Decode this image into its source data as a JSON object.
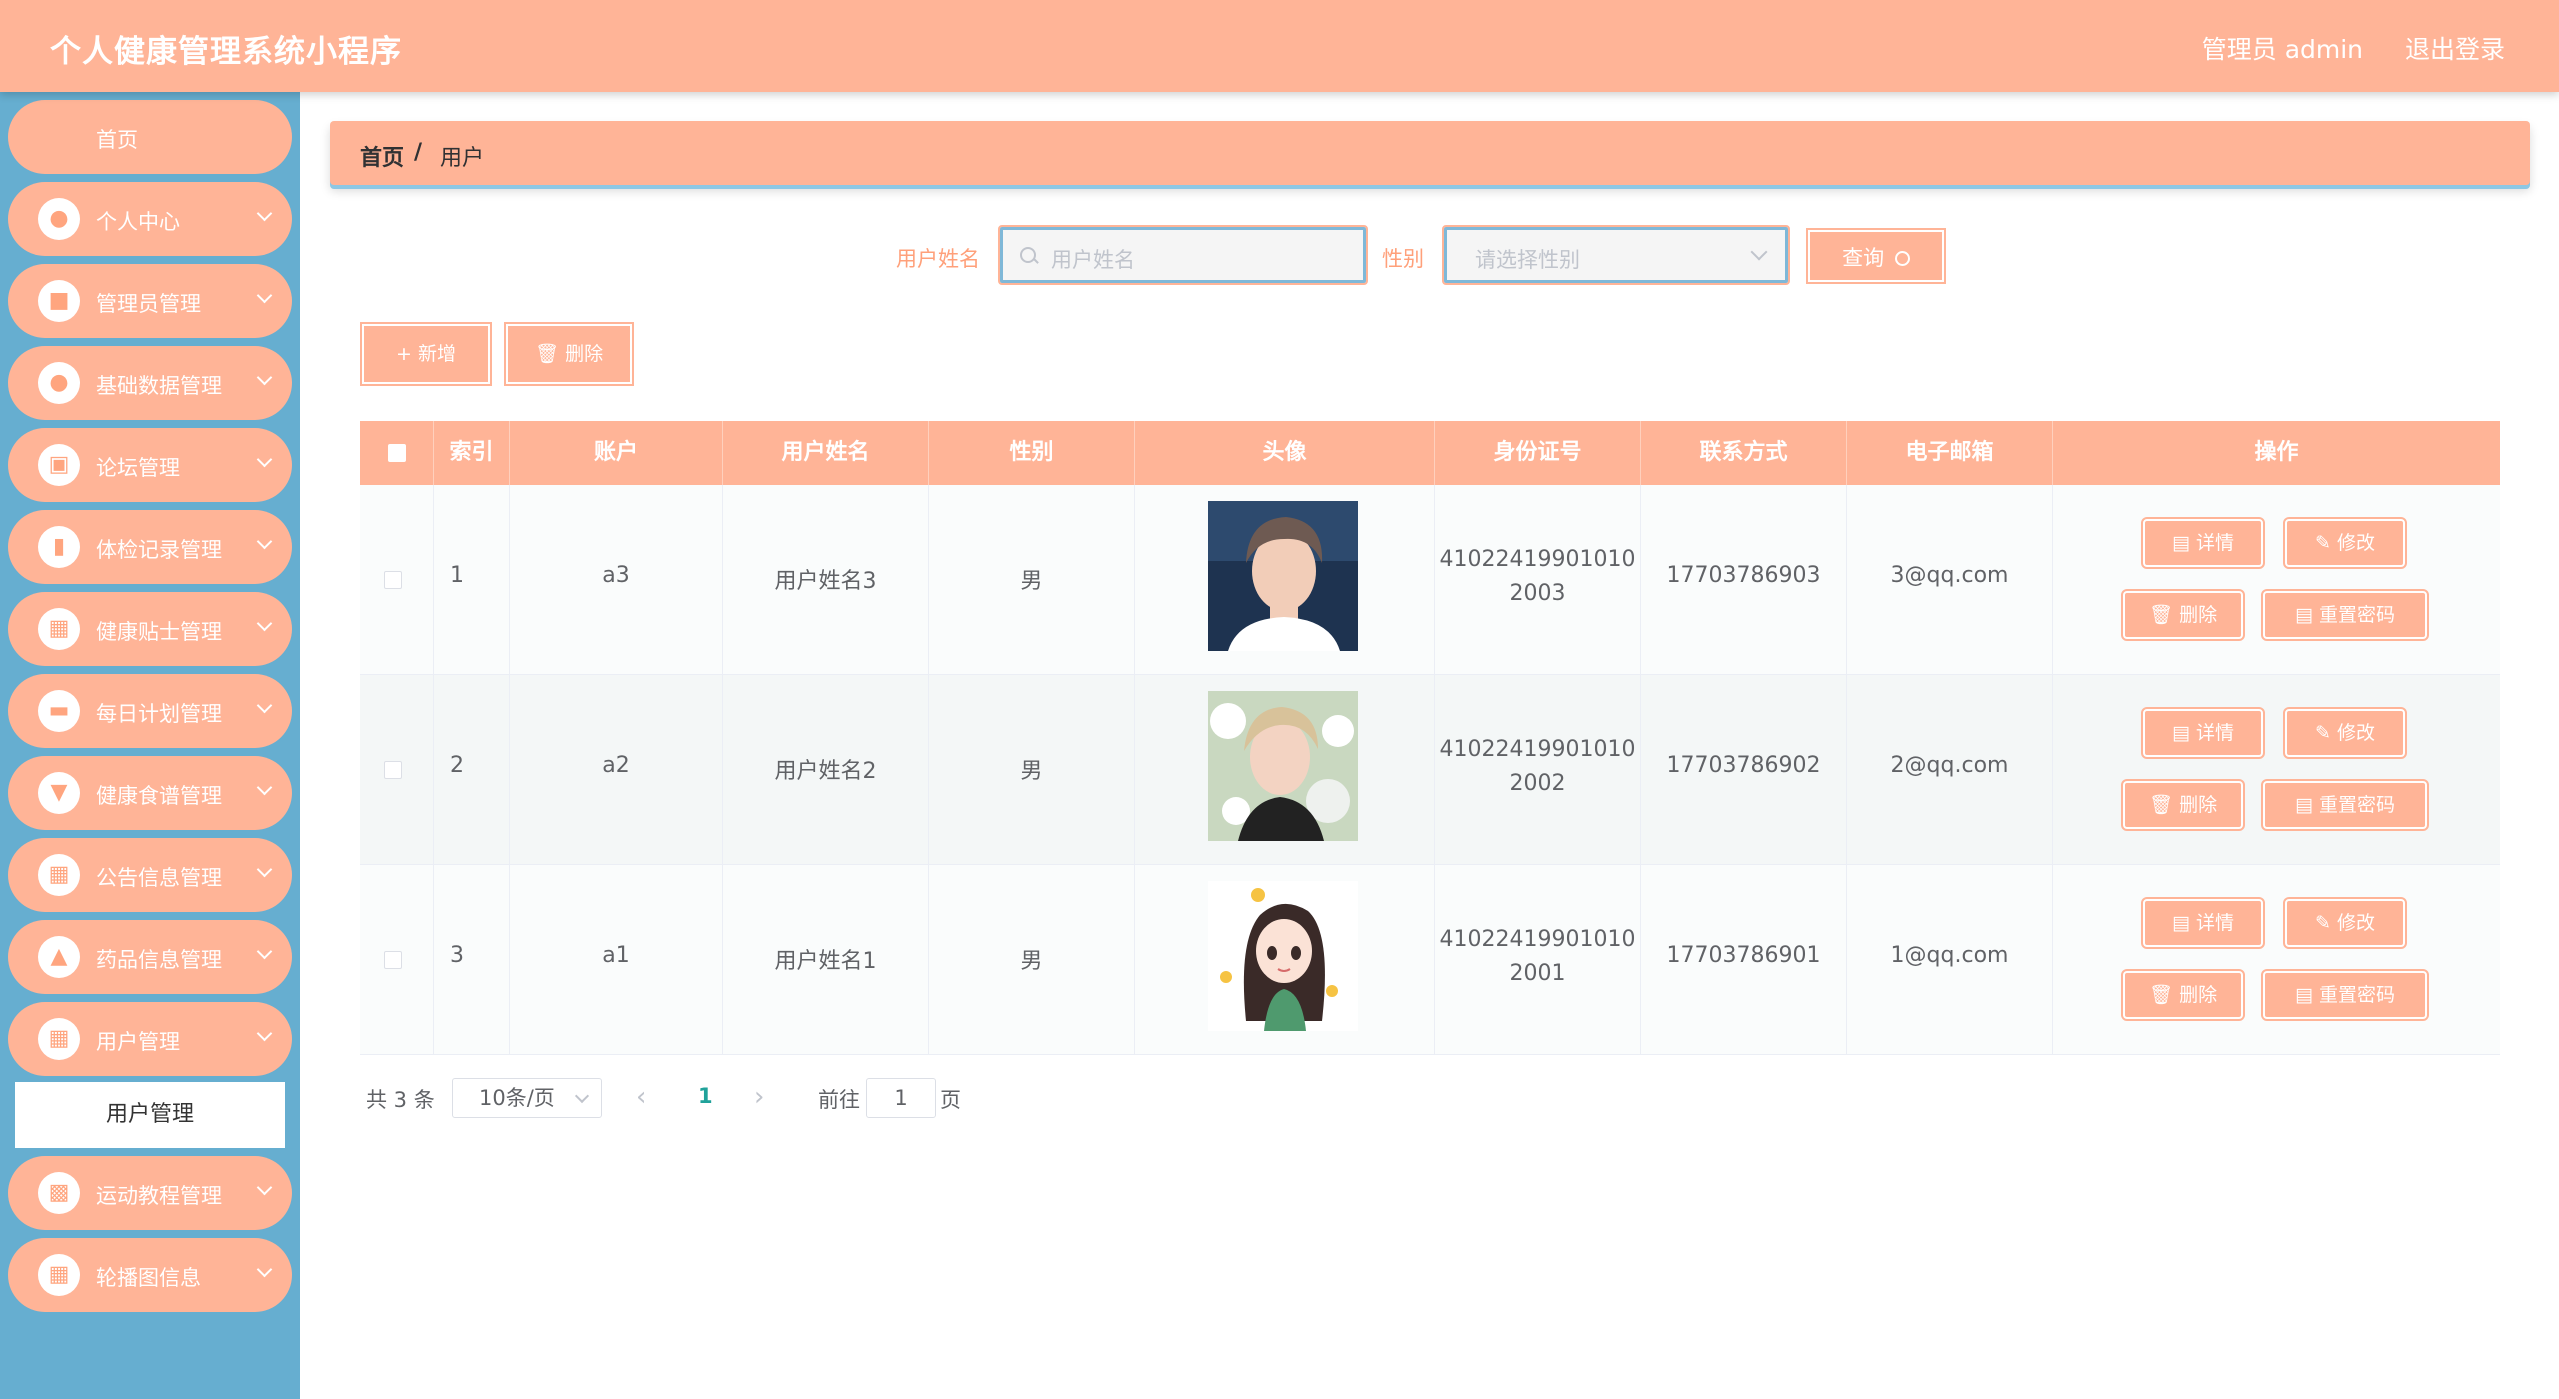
{
  "header": {
    "app_title": "个人健康管理系统小程序",
    "user_label": "管理员 admin",
    "logout_label": "退出登录"
  },
  "colors": {
    "accent": "#ffb497",
    "sidebar_bg": "#66aed0",
    "active_page": "#20a29a"
  },
  "sidebar": {
    "items": [
      {
        "label": "首页",
        "icon": "home"
      },
      {
        "label": "个人中心",
        "icon": "user-icon"
      },
      {
        "label": "管理员管理",
        "icon": "monitor-icon"
      },
      {
        "label": "基础数据管理",
        "icon": "user-icon"
      },
      {
        "label": "论坛管理",
        "icon": "briefcase-icon"
      },
      {
        "label": "体检记录管理",
        "icon": "bar-chart-icon"
      },
      {
        "label": "健康贴士管理",
        "icon": "grid-icon"
      },
      {
        "label": "每日计划管理",
        "icon": "wallet-icon"
      },
      {
        "label": "健康食谱管理",
        "icon": "cup-icon"
      },
      {
        "label": "公告信息管理",
        "icon": "grid-icon"
      },
      {
        "label": "药品信息管理",
        "icon": "chart-icon"
      },
      {
        "label": "用户管理",
        "icon": "grid-icon"
      },
      {
        "label": "运动教程管理",
        "icon": "ticket-icon"
      },
      {
        "label": "轮播图信息",
        "icon": "grid-icon"
      }
    ],
    "submenu_active": "用户管理"
  },
  "breadcrumb": {
    "home": "首页",
    "separator": "/",
    "current": "用户"
  },
  "search": {
    "name_label": "用户姓名",
    "name_placeholder": "用户姓名",
    "gender_label": "性别",
    "gender_placeholder": "请选择性别",
    "query_label": "查询"
  },
  "actions": {
    "add_label": "+ 新增",
    "delete_label": "删除"
  },
  "table": {
    "columns": [
      "索引",
      "账户",
      "用户姓名",
      "性别",
      "头像",
      "身份证号",
      "联系方式",
      "电子邮箱",
      "操作"
    ],
    "rows": [
      {
        "index": "1",
        "account": "a3",
        "name": "用户姓名3",
        "gender": "男",
        "id_line1": "41022419901010",
        "id_line2": "2003",
        "phone": "17703786903",
        "email": "3@qq.com"
      },
      {
        "index": "2",
        "account": "a2",
        "name": "用户姓名2",
        "gender": "男",
        "id_line1": "41022419901010",
        "id_line2": "2002",
        "phone": "17703786902",
        "email": "2@qq.com"
      },
      {
        "index": "3",
        "account": "a1",
        "name": "用户姓名1",
        "gender": "男",
        "id_line1": "41022419901010",
        "id_line2": "2001",
        "phone": "17703786901",
        "email": "1@qq.com"
      }
    ],
    "row_actions": {
      "detail": "详情",
      "edit": "修改",
      "delete": "删除",
      "reset_password": "重置密码"
    }
  },
  "pagination": {
    "total": "共 3 条",
    "page_size": "10条/页",
    "current_page": "1",
    "goto_label": "前往",
    "goto_value": "1",
    "page_unit": "页"
  }
}
